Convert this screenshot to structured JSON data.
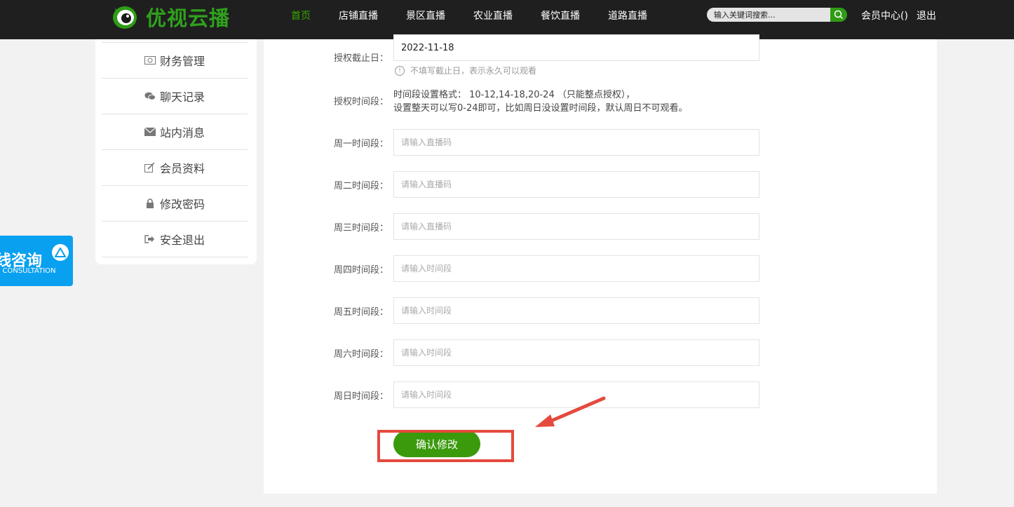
{
  "header": {
    "logo_text": "优视云播",
    "nav": [
      {
        "label": "首页",
        "active": true
      },
      {
        "label": "店铺直播",
        "active": false
      },
      {
        "label": "景区直播",
        "active": false
      },
      {
        "label": "农业直播",
        "active": false
      },
      {
        "label": "餐饮直播",
        "active": false
      },
      {
        "label": "道路直播",
        "active": false
      }
    ],
    "search_placeholder": "输入关键词搜索...",
    "member_center": "会员中心()",
    "logout": "退出"
  },
  "sidebar": {
    "items": [
      {
        "label": "财务管理",
        "icon": "money-icon"
      },
      {
        "label": "聊天记录",
        "icon": "wechat-icon"
      },
      {
        "label": "站内消息",
        "icon": "envelope-icon"
      },
      {
        "label": "会员资料",
        "icon": "edit-icon"
      },
      {
        "label": "修改密码",
        "icon": "lock-icon"
      },
      {
        "label": "安全退出",
        "icon": "sign-out-icon"
      }
    ]
  },
  "consult": {
    "cn": "线咨询",
    "en": "E CONSULTATION"
  },
  "form": {
    "expiry": {
      "label": "授权截止日：",
      "value": "2022-11-18",
      "hint": "不填写截止日，表示永久可以观看"
    },
    "period": {
      "label": "授权时间段：",
      "format_line1": "时间段设置格式： 10-12,14-18,20-24 （只能整点授权），",
      "format_line2": "设置整天可以写0-24即可，比如周日没设置时间段，默认周日不可观看。"
    },
    "days": [
      {
        "label": "周一时间段：",
        "placeholder": "请输入直播码"
      },
      {
        "label": "周二时间段：",
        "placeholder": "请输入直播码"
      },
      {
        "label": "周三时间段：",
        "placeholder": "请输入直播码"
      },
      {
        "label": "周四时间段：",
        "placeholder": "请输入时间段"
      },
      {
        "label": "周五时间段：",
        "placeholder": "请输入时间段"
      },
      {
        "label": "周六时间段：",
        "placeholder": "请输入时间段"
      },
      {
        "label": "周日时间段：",
        "placeholder": "请输入时间段"
      }
    ],
    "submit": "确认修改"
  }
}
